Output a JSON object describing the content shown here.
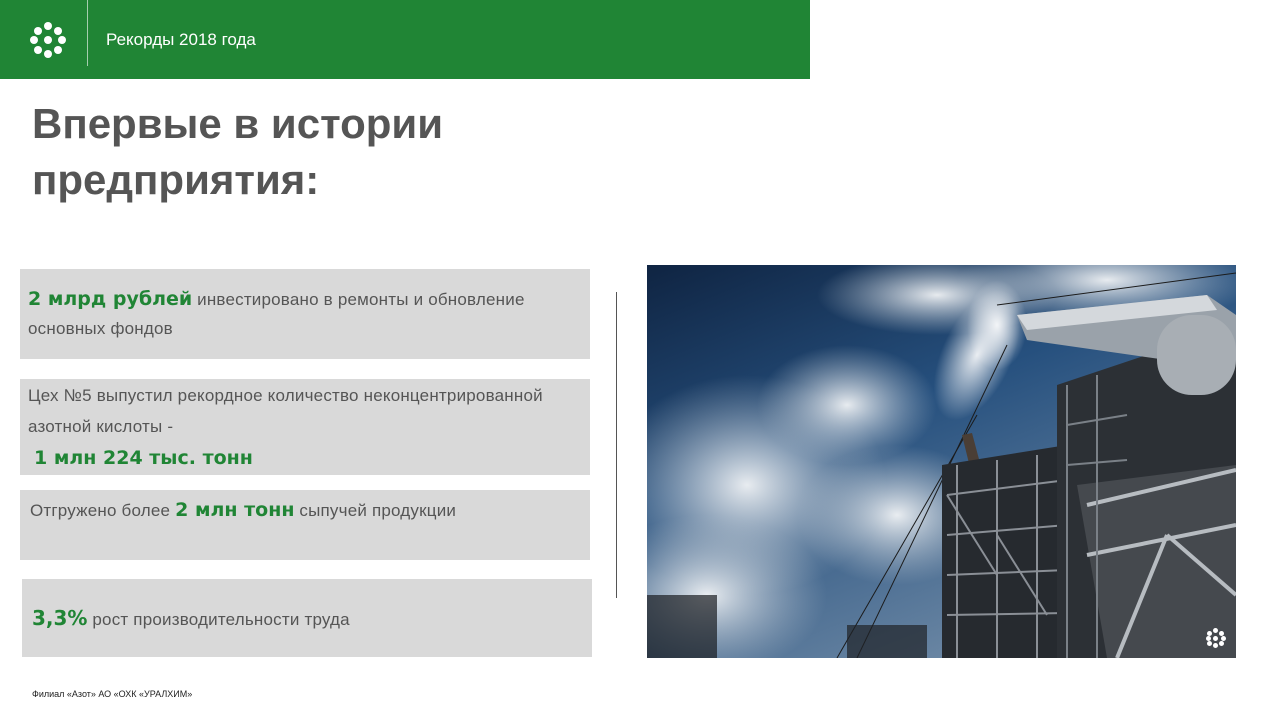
{
  "header": {
    "title": "Рекорды 2018 года",
    "background": "#208535",
    "logo_icon": "uralchem-dots-logo-icon"
  },
  "heading": {
    "line1": "Впервые в истории",
    "line2": "предприятия:"
  },
  "cards": [
    {
      "highlight": "2 млрд рублей",
      "text_after": " инвестировано  в ремонты и обновление основных фондов"
    },
    {
      "text_before": "Цех №5 выпустил рекордное количество неконцентрированной  азотной кислоты -",
      "highlight": "1 млн 224 тыс. тонн"
    },
    {
      "text_before": "Отгружено более ",
      "highlight": "2 млн тонн",
      "text_after": " сыпучей продукции"
    },
    {
      "highlight": "3,3%",
      "text_after": " рост производительности  труда"
    }
  ],
  "photo": {
    "subject": "industrial-plant-sky-photo",
    "logo_icon": "uralchem-dots-logo-icon"
  },
  "footer": {
    "text": "Филиал «Азот» АО «ОХК «УРАЛХИМ»"
  },
  "colors": {
    "accent": "#208535",
    "text": "#555555",
    "card": "#d9d9d9"
  }
}
